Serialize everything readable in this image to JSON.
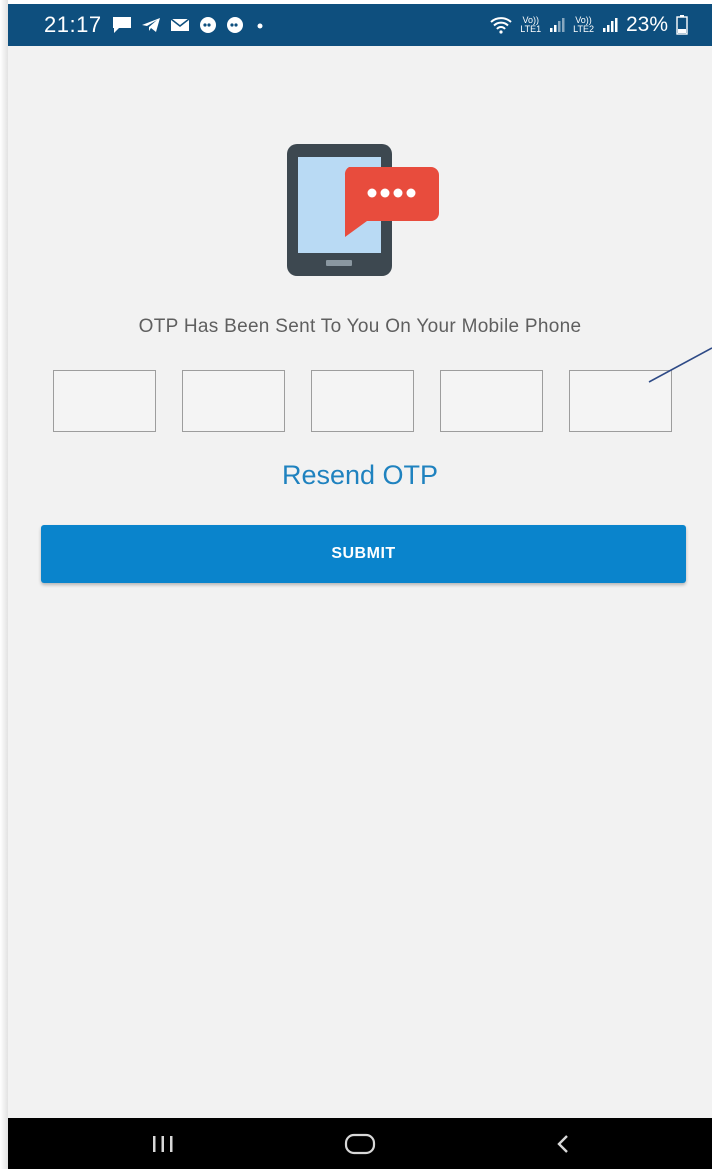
{
  "status_bar": {
    "time": "21:17",
    "net1_top": "Vo))",
    "net1_bottom": "LTE1",
    "net2_top": "Vo))",
    "net2_bottom": "LTE2",
    "battery": "23%",
    "notification_icons": [
      "message-icon",
      "telegram-icon",
      "mail-icon",
      "jio-icon",
      "jio-icon",
      "dot-icon"
    ]
  },
  "screen": {
    "illustration": "phone-sms-icon",
    "message": "OTP Has Been Sent To You On Your Mobile Phone",
    "otp_fields": [
      "",
      "",
      "",
      "",
      ""
    ],
    "resend_label": "Resend OTP",
    "submit_label": "SUBMIT"
  },
  "colors": {
    "status_bar": "#0e4f7e",
    "accent": "#1f82bf",
    "button": "#0a84cc",
    "background": "#f2f2f2"
  },
  "nav_bar": {
    "icons": [
      "recent-apps-icon",
      "home-icon",
      "back-icon"
    ]
  }
}
